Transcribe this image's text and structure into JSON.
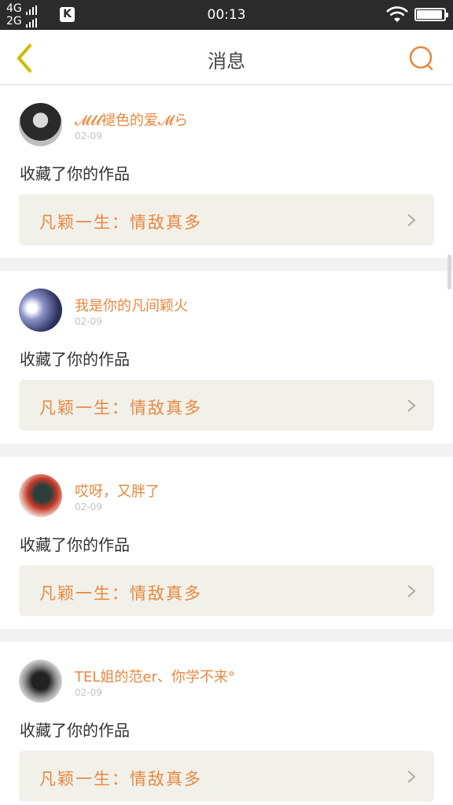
{
  "status_bar": {
    "network_top": "4G",
    "network_bottom": "2G",
    "app_badge": "K",
    "time": "00:13",
    "battery_level": 0.95
  },
  "header": {
    "title": "消息",
    "back_icon": "chevron-left-icon",
    "search_icon": "search-icon"
  },
  "colors": {
    "accent": "#e9873f",
    "back_arrow": "#e7d320",
    "card_link_bg": "#f1f1ea"
  },
  "notifications": [
    {
      "username": "𝓜𝓵𝓵褪色的爱𝓜ら",
      "date": "02-09",
      "action": "收藏了你的作品",
      "work_title": "凡颖一生：情敌真多"
    },
    {
      "username": "我是你的凡间颖火",
      "date": "02-09",
      "action": "收藏了你的作品",
      "work_title": "凡颖一生：情敌真多"
    },
    {
      "username": "哎呀，又胖了",
      "date": "02-09",
      "action": "收藏了你的作品",
      "work_title": "凡颖一生：情敌真多"
    },
    {
      "username": "TEL姐的范er、你学不来°",
      "date": "02-09",
      "action": "收藏了你的作品",
      "work_title": "凡颖一生：情敌真多"
    }
  ]
}
